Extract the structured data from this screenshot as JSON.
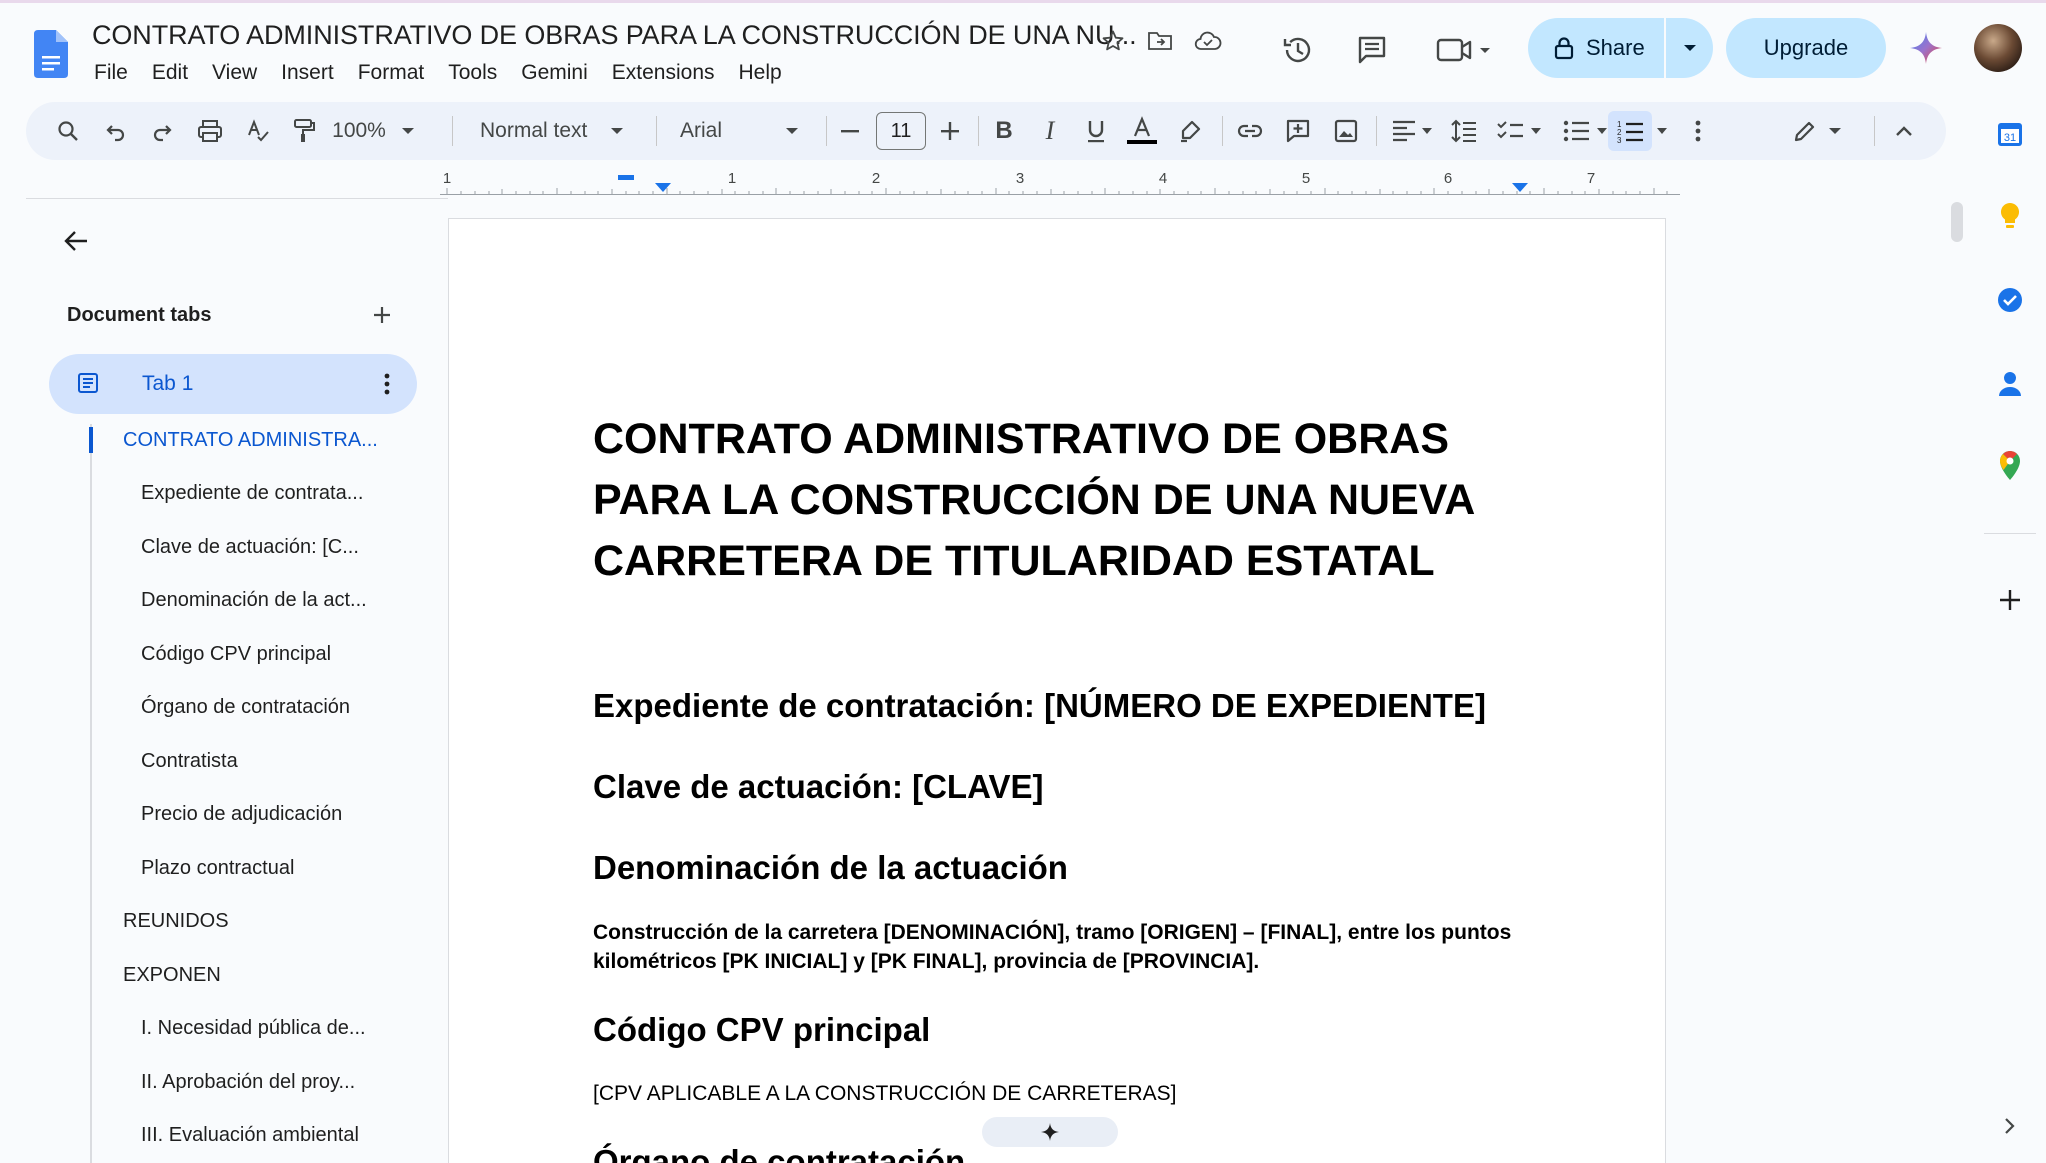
{
  "header": {
    "doc_title": "CONTRATO ADMINISTRATIVO DE OBRAS PARA LA CONSTRUCCIÓN DE UNA NU...",
    "menu": [
      "File",
      "Edit",
      "View",
      "Insert",
      "Format",
      "Tools",
      "Gemini",
      "Extensions",
      "Help"
    ],
    "share_label": "Share",
    "upgrade_label": "Upgrade"
  },
  "toolbar": {
    "zoom": "100%",
    "style": "Normal text",
    "font": "Arial",
    "font_size": "11"
  },
  "ruler": {
    "numbers": [
      "1",
      "1",
      "2",
      "3",
      "4",
      "5",
      "6",
      "7"
    ]
  },
  "sidebar": {
    "title": "Document tabs",
    "tab_label": "Tab 1",
    "outline": [
      "CONTRATO ADMINISTRA...",
      "Expediente de contrata...",
      "Clave de actuación: [C...",
      "Denominación de la act...",
      "Código CPV principal",
      "Órgano de contratación",
      "Contratista",
      "Precio de adjudicación",
      "Plazo contractual",
      "REUNIDOS",
      "EXPONEN",
      "I. Necesidad pública de...",
      "II. Aprobación del proy...",
      "III. Evaluación ambiental"
    ]
  },
  "document": {
    "title": "CONTRATO ADMINISTRATIVO DE OBRAS PARA LA CONSTRUCCIÓN DE UNA NUEVA CARRETERA DE TITULARIDAD ESTATAL",
    "h_expediente": "Expediente de contratación: [NÚMERO DE EXPEDIENTE]",
    "h_clave": "Clave de actuación: [CLAVE]",
    "h_denominacion": "Denominación de la actuación",
    "p_denominacion": "Construcción de la carretera [DENOMINACIÓN], tramo [ORIGEN] – [FINAL], entre los puntos kilométricos [PK INICIAL] y [PK FINAL], provincia de [PROVINCIA].",
    "h_cpv": "Código CPV principal",
    "p_cpv": "[CPV APLICABLE A LA CONSTRUCCIÓN DE CARRETERAS]",
    "h_organo": "Órgano de contratación"
  },
  "side_panel": {
    "calendar_day": "31"
  },
  "colors": {
    "accent": "#0b57d0",
    "share_bg": "#c2e7ff",
    "toolbar_bg": "#edf2fa",
    "active_tab_bg": "#d3e3fd"
  }
}
